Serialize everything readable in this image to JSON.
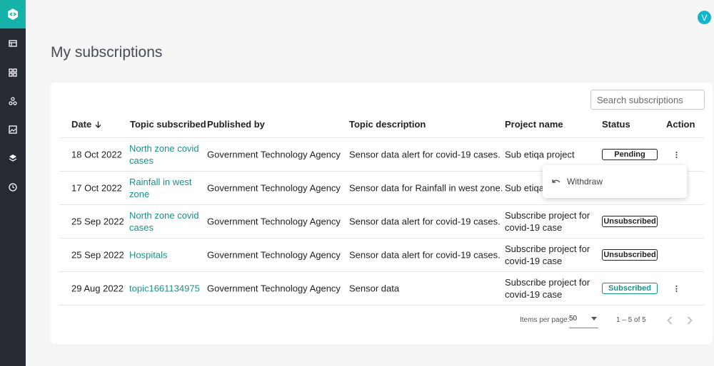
{
  "colors": {
    "sidebar": "#262b33",
    "accent": "#14b2a8",
    "link": "#1b8f87",
    "avatar": "#12b5cb"
  },
  "user": {
    "avatar_initial": "V"
  },
  "sidebar": {
    "icons": [
      "logo-icon",
      "catalog-icon",
      "dashboard-grid-icon",
      "topics-icon",
      "gallery-icon",
      "layers-icon",
      "history-clock-icon"
    ]
  },
  "page": {
    "title": "My subscriptions"
  },
  "search": {
    "placeholder": "Search subscriptions"
  },
  "table": {
    "headers": {
      "date": "Date",
      "sort_icon": "arrow-down-icon",
      "topic": "Topic subscribed",
      "publisher": "Published by",
      "description": "Topic description",
      "project": "Project name",
      "status": "Status",
      "action": "Action"
    },
    "rows": [
      {
        "date": "18 Oct 2022",
        "topic": "North zone covid cases",
        "publisher": "Government Technology Agency",
        "description": "Sensor data alert for covid-19 cases.",
        "project": "Sub etiqa project",
        "status": "Pending"
      },
      {
        "date": "17 Oct 2022",
        "topic": "Rainfall in west zone",
        "publisher": "Government Technology Agency",
        "description": "Sensor data for Rainfall in west zone.",
        "project": "Sub etiqa",
        "status": ""
      },
      {
        "date": "25 Sep 2022",
        "topic": "North zone covid cases",
        "publisher": "Government Technology Agency",
        "description": "Sensor data alert for covid-19 cases.",
        "project": "Subscribe project for covid-19 case",
        "status": "Unsubscribed"
      },
      {
        "date": "25 Sep 2022",
        "topic": "Hospitals",
        "publisher": "Government Technology Agency",
        "description": "Sensor data alert for covid-19 cases.",
        "project": "Subscribe project for covid-19 case",
        "status": "Unsubscribed"
      },
      {
        "date": "29 Aug 2022",
        "topic": "topic1661134975",
        "publisher": "Government Technology Agency",
        "description": "Sensor data",
        "project": "Subscribe project for covid-19 case",
        "status": "Subscribed"
      }
    ]
  },
  "popup_menu": {
    "withdraw_label": "Withdraw"
  },
  "pagination": {
    "items_per_page_label": "Items per page:",
    "items_per_page_value": "50",
    "range": "1 – 5 of 5"
  }
}
